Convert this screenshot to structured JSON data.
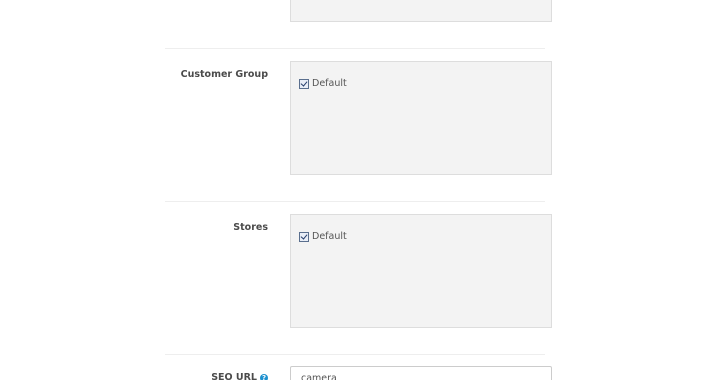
{
  "form": {
    "customer_group": {
      "label": "Customer Group",
      "options": [
        {
          "label": "Default",
          "checked": true
        }
      ]
    },
    "stores": {
      "label": "Stores",
      "options": [
        {
          "label": "Default",
          "checked": true
        }
      ]
    },
    "seo_url": {
      "label": "SEO URL",
      "value": "camera",
      "help_icon": "question-circle-icon"
    }
  },
  "colors": {
    "box_background": "#f3f3f3",
    "help_icon": "#1e91cf"
  }
}
